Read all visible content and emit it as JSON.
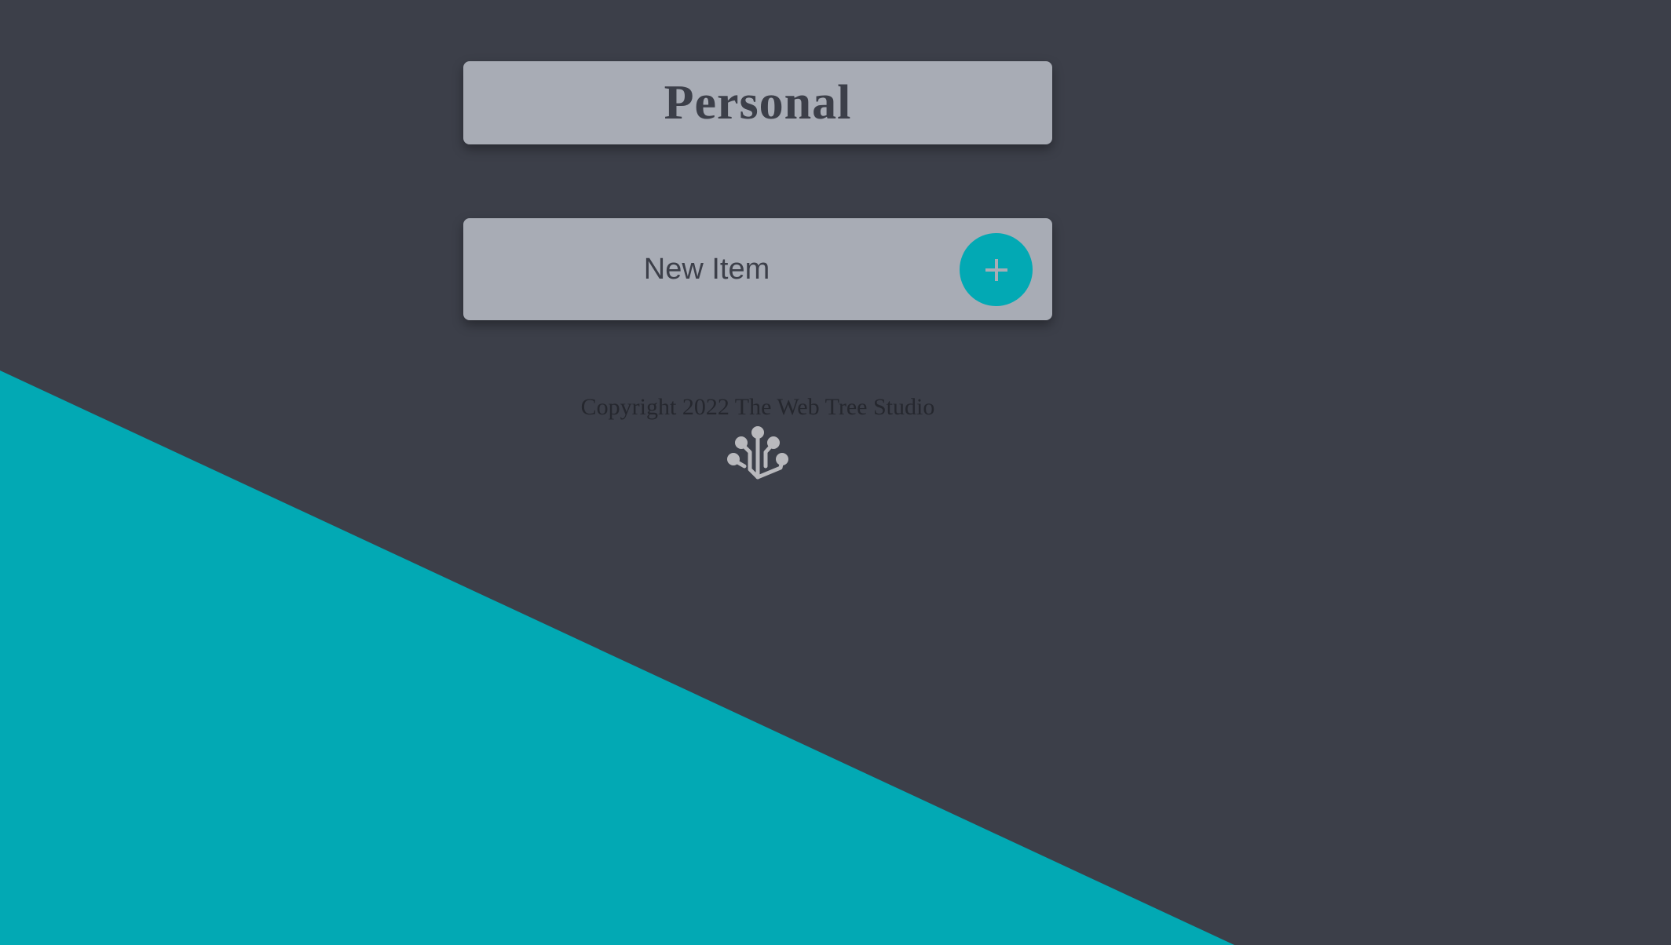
{
  "list": {
    "title": "Personal"
  },
  "new_item": {
    "placeholder": "New Item",
    "add_button_symbol": "+"
  },
  "footer": {
    "copyright": "Copyright 2022 The Web Tree Studio",
    "logo_icon": "tree-circuit-icon"
  },
  "colors": {
    "background": "#3c3f49",
    "accent": "#02a9b4",
    "card": "#a8acb5",
    "text_dark": "#3c3f49"
  }
}
